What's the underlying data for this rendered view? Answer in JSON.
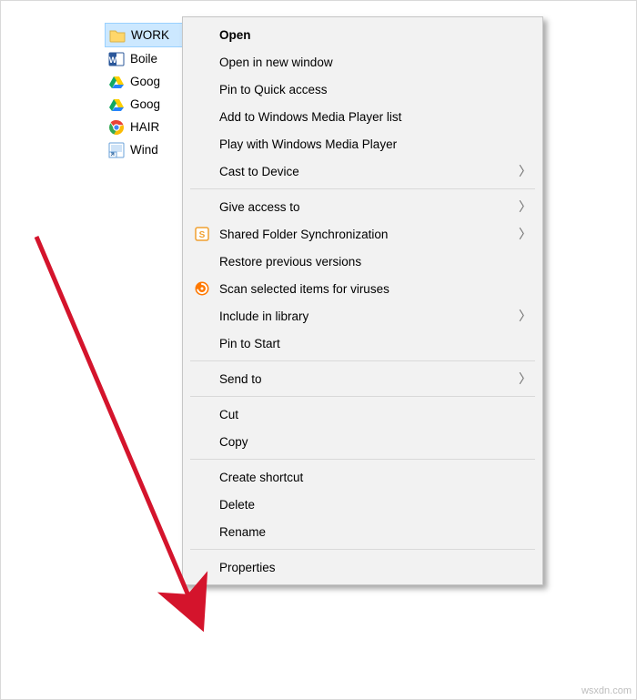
{
  "files": [
    {
      "name": "WORK",
      "type": "folder",
      "selected": true
    },
    {
      "name": "Boile",
      "type": "word"
    },
    {
      "name": "Goog",
      "type": "gdrive"
    },
    {
      "name": "Goog",
      "type": "gdrive"
    },
    {
      "name": "HAIR",
      "type": "chrome"
    },
    {
      "name": "Wind",
      "type": "shortcut"
    }
  ],
  "menu": {
    "open": "Open",
    "open_new_window": "Open in new window",
    "pin_quick_access": "Pin to Quick access",
    "add_wmp_list": "Add to Windows Media Player list",
    "play_wmp": "Play with Windows Media Player",
    "cast_device": "Cast to Device",
    "give_access": "Give access to",
    "shared_folder_sync": "Shared Folder Synchronization",
    "restore_versions": "Restore previous versions",
    "scan_viruses": "Scan selected items for viruses",
    "include_library": "Include in library",
    "pin_start": "Pin to Start",
    "send_to": "Send to",
    "cut": "Cut",
    "copy": "Copy",
    "create_shortcut": "Create shortcut",
    "delete": "Delete",
    "rename": "Rename",
    "properties": "Properties"
  },
  "watermark": "wsxdn.com"
}
